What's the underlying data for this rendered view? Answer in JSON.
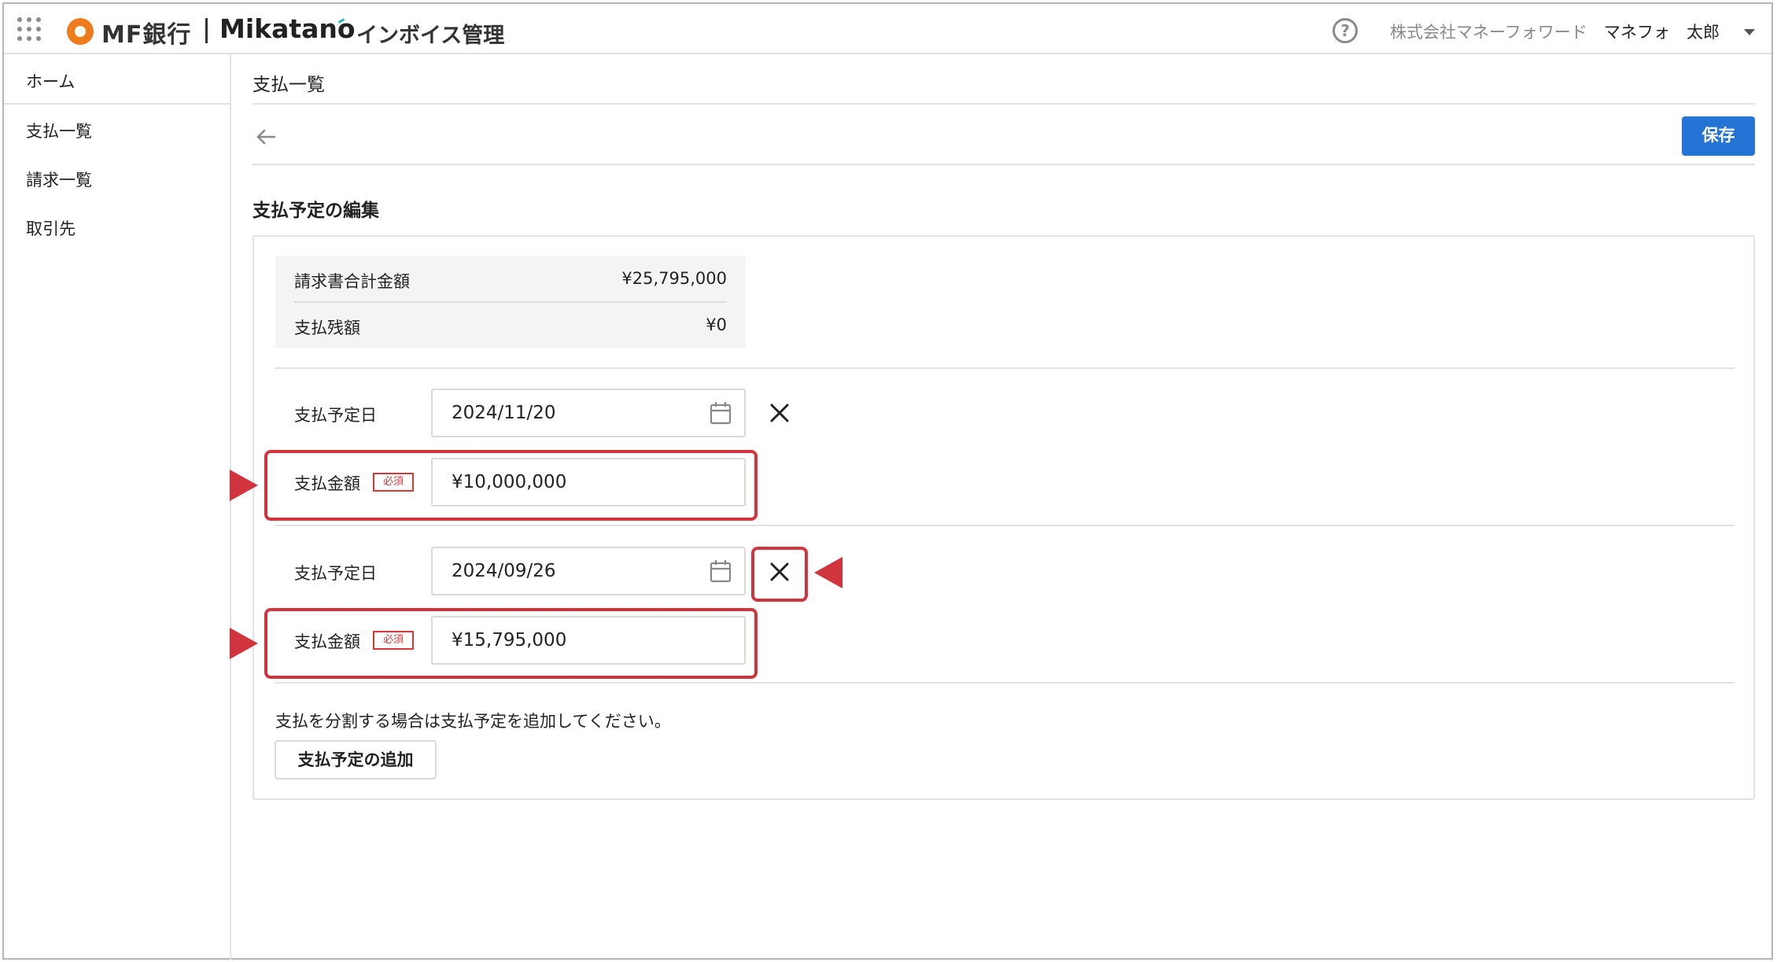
{
  "header": {
    "brand_bank": "MF銀行",
    "brand_product_name": "Mikatano",
    "brand_product_suffix": "インボイス管理",
    "help_icon_char": "?",
    "company": "株式会社マネーフォワード",
    "user": "マネフォ　太郎",
    "logo_color": "#ee7b1c"
  },
  "sidebar": {
    "items": [
      {
        "label": "ホーム"
      },
      {
        "label": "支払一覧"
      },
      {
        "label": "請求一覧"
      },
      {
        "label": "取引先"
      }
    ]
  },
  "main": {
    "page_title": "支払一覧",
    "save_label": "保存",
    "section_title": "支払予定の編集",
    "summary": {
      "total_label": "請求書合計金額",
      "total_value": "¥25,795,000",
      "remaining_label": "支払残額",
      "remaining_value": "¥0"
    },
    "schedules": [
      {
        "date_label": "支払予定日",
        "date_value": "2024/11/20",
        "amount_label": "支払金額",
        "required_badge": "必須",
        "amount_value": "¥10,000,000"
      },
      {
        "date_label": "支払予定日",
        "date_value": "2024/09/26",
        "amount_label": "支払金額",
        "required_badge": "必須",
        "amount_value": "¥15,795,000"
      }
    ],
    "hint": "支払を分割する場合は支払予定を追加してください。",
    "add_label": "支払予定の追加"
  },
  "colors": {
    "primary": "#2673d6",
    "annotation": "#d0343c",
    "required": "#d63a3a"
  }
}
